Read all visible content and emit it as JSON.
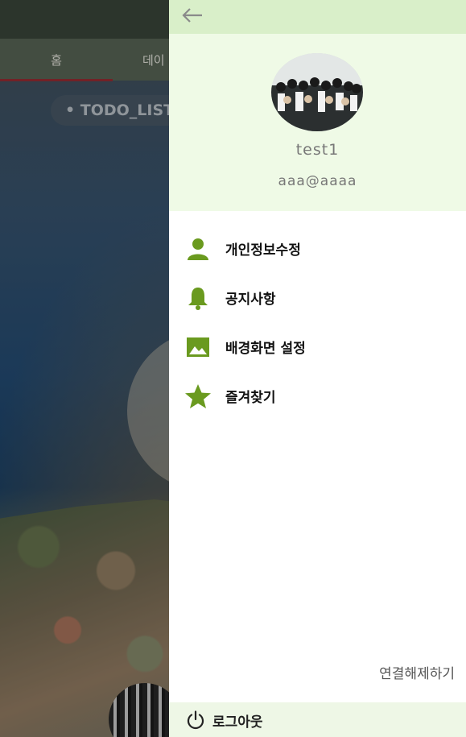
{
  "background": {
    "tabs": [
      {
        "label": "홈"
      },
      {
        "label": "데이"
      }
    ],
    "todo_chip": "• TODO_LIST"
  },
  "drawer": {
    "back_icon": "arrow-left-icon",
    "profile": {
      "name": "test1",
      "email": "aaa@aaaa"
    },
    "menu": [
      {
        "label": "개인정보수정",
        "icon": "person-icon"
      },
      {
        "label": "공지사항",
        "icon": "bell-icon"
      },
      {
        "label": "배경화면 설정",
        "icon": "image-icon"
      },
      {
        "label": "즐겨찾기",
        "icon": "star-icon"
      }
    ],
    "disconnect_label": "연결해제하기",
    "logout": {
      "label": "로그아웃",
      "icon": "power-icon"
    }
  },
  "colors": {
    "accent_green": "#6a9a1f",
    "drawer_header": "#effae6",
    "drawer_topbar": "#d9efc9",
    "tab_indicator": "#9e3037"
  }
}
